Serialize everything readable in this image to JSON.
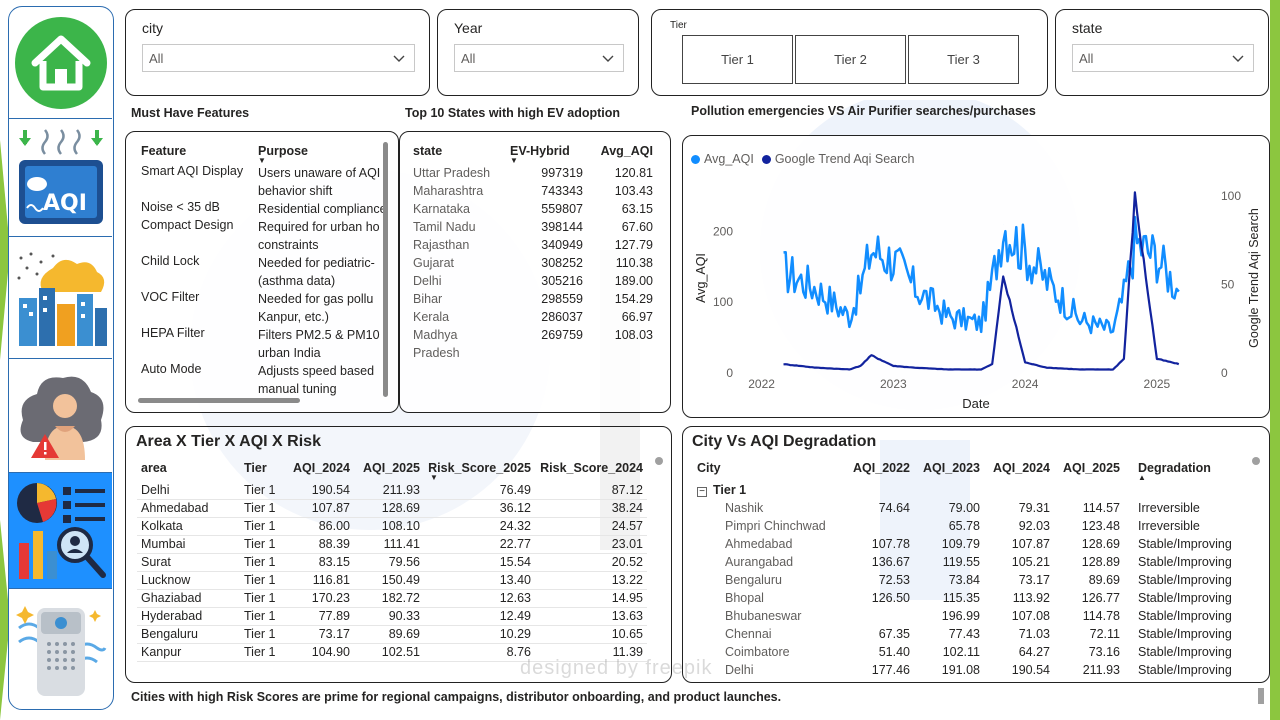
{
  "nav": {
    "items": [
      {
        "name": "home"
      },
      {
        "name": "aqi-monitor"
      },
      {
        "name": "polluted-city"
      },
      {
        "name": "health-risk"
      },
      {
        "name": "analytics-report"
      },
      {
        "name": "air-purifier"
      }
    ],
    "selected_index": 4
  },
  "slicers": {
    "city": {
      "title": "city",
      "value": "All"
    },
    "year": {
      "title": "Year",
      "value": "All"
    },
    "tier": {
      "title": "Tier",
      "buttons": [
        "Tier 1",
        "Tier 2",
        "Tier 3"
      ]
    },
    "state": {
      "title": "state",
      "value": "All"
    }
  },
  "features": {
    "title": "Must Have Features",
    "headers": [
      "Feature",
      "Purpose"
    ],
    "rows": [
      {
        "feature": "Smart AQI Display",
        "purpose": "Users unaware of AQI",
        "purpose2": "behavior shift"
      },
      {
        "feature": "Noise < 35 dB",
        "purpose": "Residential compliance",
        "purpose2": ""
      },
      {
        "feature": "Compact Design",
        "purpose": "Required for urban ho",
        "purpose2": "constraints"
      },
      {
        "feature": "Child Lock",
        "purpose": "Needed for pediatric-",
        "purpose2": "(asthma data)"
      },
      {
        "feature": "VOC Filter",
        "purpose": "Needed for gas pollu",
        "purpose2": "Kanpur, etc.)"
      },
      {
        "feature": "HEPA Filter",
        "purpose": "Filters PM2.5 & PM10",
        "purpose2": "urban India"
      },
      {
        "feature": "Auto Mode",
        "purpose": "Adjusts speed based",
        "purpose2": "manual tuning"
      }
    ]
  },
  "ev": {
    "title": "Top 10 States with high EV adoption",
    "headers": [
      "state",
      "EV-Hybrid",
      "Avg_AQI"
    ],
    "rows": [
      {
        "state": "Uttar Pradesh",
        "ev": "997319",
        "aqi": "120.81"
      },
      {
        "state": "Maharashtra",
        "ev": "743343",
        "aqi": "103.43"
      },
      {
        "state": "Karnataka",
        "ev": "559807",
        "aqi": "63.15"
      },
      {
        "state": "Tamil Nadu",
        "ev": "398144",
        "aqi": "67.60"
      },
      {
        "state": "Rajasthan",
        "ev": "340949",
        "aqi": "127.79"
      },
      {
        "state": "Gujarat",
        "ev": "308252",
        "aqi": "110.38"
      },
      {
        "state": "Delhi",
        "ev": "305216",
        "aqi": "189.00"
      },
      {
        "state": "Bihar",
        "ev": "298559",
        "aqi": "154.29"
      },
      {
        "state": "Kerala",
        "ev": "286037",
        "aqi": "66.97"
      },
      {
        "state": "Madhya",
        "ev": "269759",
        "aqi": "108.03"
      },
      {
        "state": "Pradesh",
        "ev": "",
        "aqi": ""
      }
    ]
  },
  "pollution_chart": {
    "title": "Pollution emergencies VS Air Purifier searches/purchases",
    "legend": [
      {
        "name": "Avg_AQI",
        "color": "#118dff"
      },
      {
        "name": "Google Trend Aqi Search",
        "color": "#12239e"
      }
    ],
    "xlabel": "Date",
    "ylabel_left": "Avg_AQI",
    "ylabel_right": "Google Trend Aqi Search",
    "x_ticks": [
      "2022",
      "2023",
      "2024",
      "2025"
    ],
    "y_left_ticks": [
      "0",
      "100",
      "200"
    ],
    "y_right_ticks": [
      "0",
      "50",
      "100"
    ]
  },
  "chart_data": {
    "type": "line",
    "x": [
      "2022-03",
      "2022-06",
      "2022-09",
      "2022-10",
      "2022-11",
      "2023-01",
      "2023-03",
      "2023-06",
      "2023-09",
      "2023-10",
      "2023-11",
      "2024-01",
      "2024-03",
      "2024-06",
      "2024-09",
      "2024-10",
      "2024-11",
      "2025-01",
      "2025-03"
    ],
    "series": [
      {
        "name": "Avg_AQI",
        "axis": "left",
        "values": [
          145,
          120,
          80,
          120,
          175,
          160,
          120,
          80,
          70,
          130,
          210,
          170,
          130,
          75,
          60,
          110,
          185,
          165,
          115
        ]
      },
      {
        "name": "Google Trend Aqi Search",
        "axis": "right",
        "values": [
          5,
          3,
          2,
          4,
          10,
          4,
          3,
          2,
          2,
          5,
          55,
          6,
          3,
          2,
          2,
          8,
          100,
          8,
          5
        ]
      }
    ],
    "ylim_left": [
      0,
      250
    ],
    "ylim_right": [
      0,
      100
    ],
    "xlabel": "Date",
    "ylabel": "Avg_AQI",
    "y2label": "Google Trend Aqi Search"
  },
  "risk": {
    "title": "Area X Tier X AQI X Risk",
    "headers": [
      "area",
      "Tier",
      "AQI_2024",
      "AQI_2025",
      "Risk_Score_2025",
      "Risk_Score_2024"
    ],
    "rows": [
      [
        "Delhi",
        "Tier 1",
        "190.54",
        "211.93",
        "76.49",
        "87.12"
      ],
      [
        "Ahmedabad",
        "Tier 1",
        "107.87",
        "128.69",
        "36.12",
        "38.24"
      ],
      [
        "Kolkata",
        "Tier 1",
        "86.00",
        "108.10",
        "24.32",
        "24.57"
      ],
      [
        "Mumbai",
        "Tier 1",
        "88.39",
        "111.41",
        "22.77",
        "23.01"
      ],
      [
        "Surat",
        "Tier 1",
        "83.15",
        "79.56",
        "15.54",
        "20.52"
      ],
      [
        "Lucknow",
        "Tier 1",
        "116.81",
        "150.49",
        "13.40",
        "13.22"
      ],
      [
        "Ghaziabad",
        "Tier 1",
        "170.23",
        "182.72",
        "12.63",
        "14.95"
      ],
      [
        "Hyderabad",
        "Tier 1",
        "77.89",
        "90.33",
        "12.49",
        "13.63"
      ],
      [
        "Bengaluru",
        "Tier 1",
        "73.17",
        "89.69",
        "10.29",
        "10.65"
      ],
      [
        "Kanpur",
        "Tier 1",
        "104.90",
        "102.51",
        "8.76",
        "11.39"
      ]
    ]
  },
  "degradation": {
    "title": "City Vs AQI Degradation",
    "headers": [
      "City",
      "AQI_2022",
      "AQI_2023",
      "AQI_2024",
      "AQI_2025",
      "Degradation"
    ],
    "group_label": "Tier 1",
    "rows": [
      [
        "Nashik",
        "74.64",
        "79.00",
        "79.31",
        "114.57",
        "Irreversible"
      ],
      [
        "Pimpri Chinchwad",
        "",
        "65.78",
        "92.03",
        "123.48",
        "Irreversible"
      ],
      [
        "Ahmedabad",
        "107.78",
        "109.79",
        "107.87",
        "128.69",
        "Stable/Improving"
      ],
      [
        "Aurangabad",
        "136.67",
        "119.55",
        "105.21",
        "128.89",
        "Stable/Improving"
      ],
      [
        "Bengaluru",
        "72.53",
        "73.84",
        "73.17",
        "89.69",
        "Stable/Improving"
      ],
      [
        "Bhopal",
        "126.50",
        "115.35",
        "113.92",
        "126.77",
        "Stable/Improving"
      ],
      [
        "Bhubaneswar",
        "",
        "196.99",
        "107.08",
        "114.78",
        "Stable/Improving"
      ],
      [
        "Chennai",
        "67.35",
        "77.43",
        "71.03",
        "72.11",
        "Stable/Improving"
      ],
      [
        "Coimbatore",
        "51.40",
        "102.11",
        "64.27",
        "73.16",
        "Stable/Improving"
      ],
      [
        "Delhi",
        "177.46",
        "191.08",
        "190.54",
        "211.93",
        "Stable/Improving"
      ]
    ]
  },
  "footer": "Cities with high Risk Scores are prime for regional campaigns, distributor onboarding, and product launches.",
  "watermark": "designed by  freepik"
}
